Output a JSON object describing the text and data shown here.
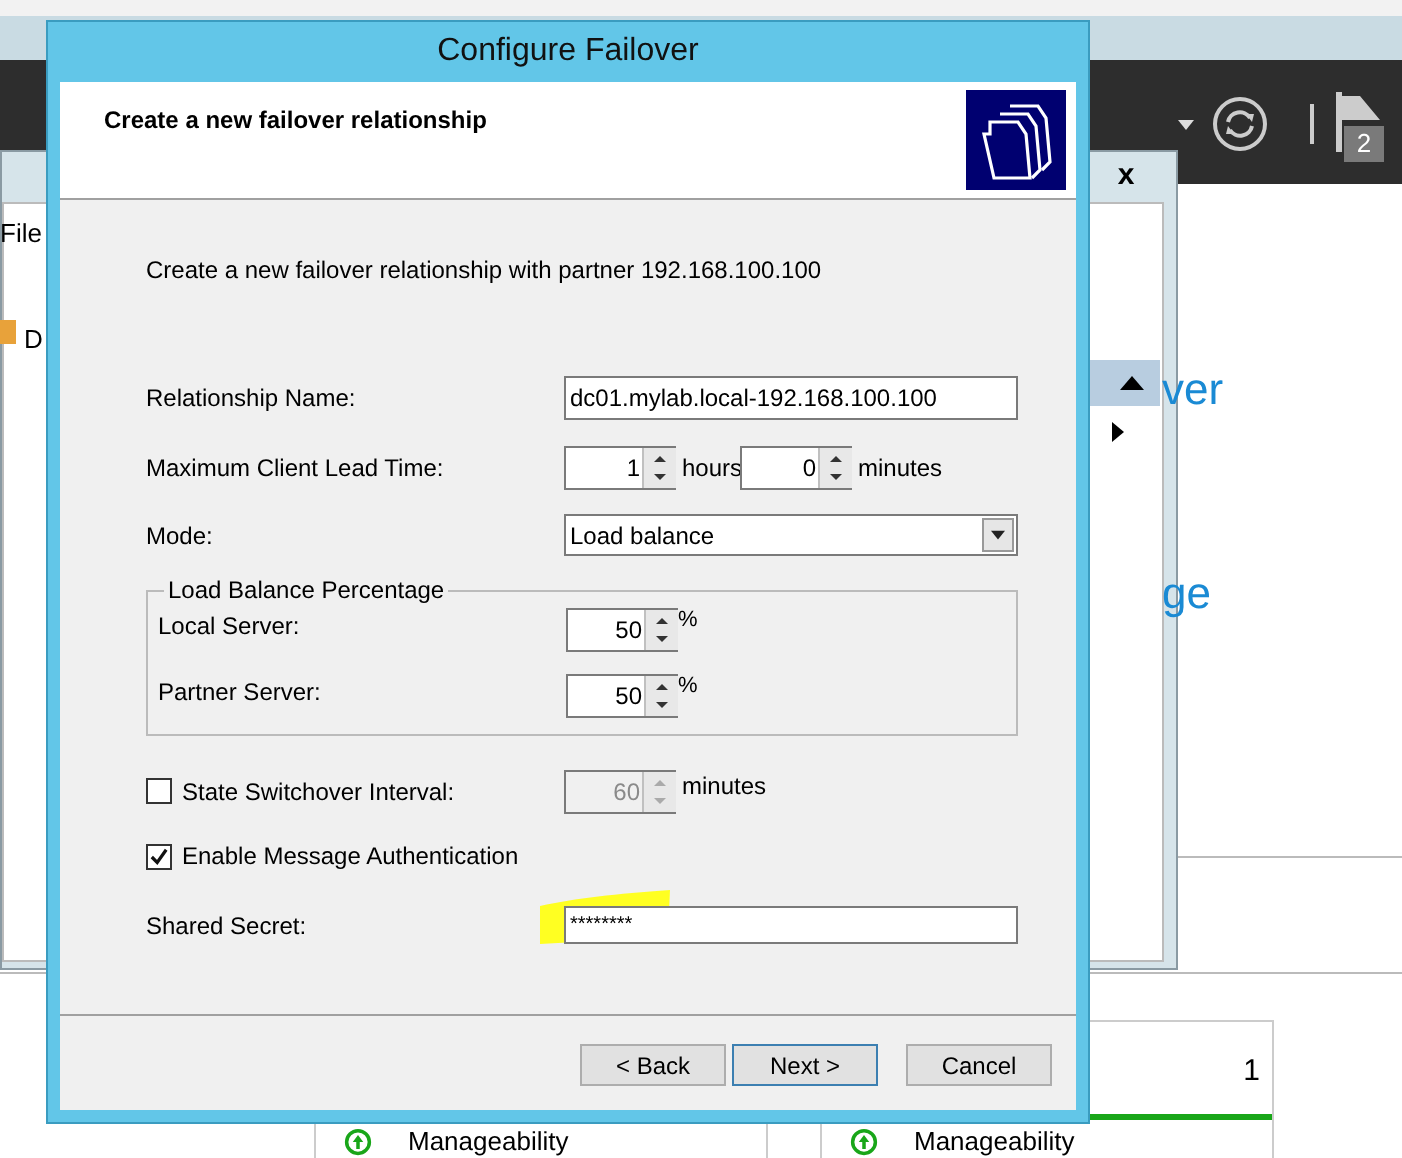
{
  "background": {
    "menu_item": "File",
    "tree_item": "D",
    "side_texts": [
      "ver",
      "ge"
    ],
    "notification_count": "2",
    "close_glyph": "x",
    "tiles": [
      {
        "label": "Manageability"
      },
      {
        "label": "Manageability",
        "count": "1"
      }
    ]
  },
  "dialog": {
    "title": "Configure Failover",
    "header": "Create a new failover relationship",
    "intro": "Create a new failover relationship with partner 192.168.100.100",
    "relationship_name": {
      "label": "Relationship Name:",
      "value": "dc01.mylab.local-192.168.100.100"
    },
    "lead_time": {
      "label": "Maximum Client Lead Time:",
      "hours": {
        "value": "1",
        "unit": "hours"
      },
      "minutes": {
        "value": "0",
        "unit": "minutes"
      }
    },
    "mode": {
      "label": "Mode:",
      "value": "Load balance"
    },
    "load_balance": {
      "title": "Load Balance Percentage",
      "local": {
        "label": "Local Server:",
        "value": "50",
        "unit": "%"
      },
      "partner": {
        "label": "Partner Server:",
        "value": "50",
        "unit": "%"
      }
    },
    "state_switchover": {
      "label": "State Switchover Interval:",
      "checked": false,
      "disabled": true,
      "value": "60",
      "unit": "minutes"
    },
    "message_auth": {
      "label": "Enable Message Authentication",
      "checked": true
    },
    "shared_secret": {
      "label": "Shared Secret:",
      "value": "********"
    },
    "buttons": [
      {
        "label": "< Back",
        "default": false
      },
      {
        "label": "Next >",
        "default": true
      },
      {
        "label": "Cancel",
        "default": false
      }
    ]
  }
}
